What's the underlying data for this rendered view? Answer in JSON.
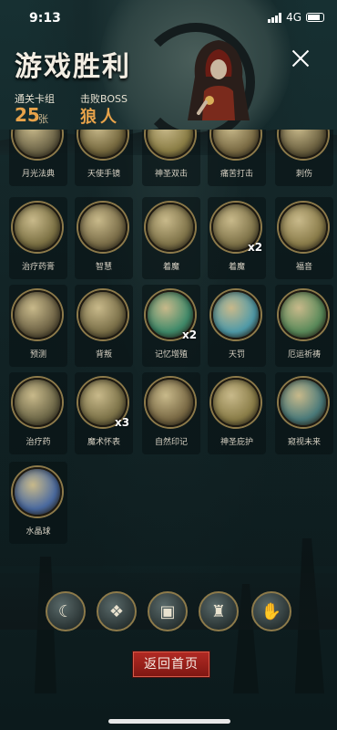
{
  "status_bar": {
    "time": "9:13",
    "network": "4G"
  },
  "header": {
    "title": "游戏胜利",
    "deck_label": "通关卡组",
    "deck_count": "25",
    "deck_unit": "张",
    "boss_label": "击败BOSS",
    "boss_name": "狼人"
  },
  "cards": [
    {
      "label": "月光法典",
      "icon": "book-icon",
      "color": "#6d6548",
      "multiplier": ""
    },
    {
      "label": "天使手镜",
      "icon": "mirror-icon",
      "color": "#76693f",
      "multiplier": ""
    },
    {
      "label": "神圣双击",
      "icon": "holy-hands-icon",
      "color": "#8a7d45",
      "multiplier": ""
    },
    {
      "label": "痛苦打击",
      "icon": "fist-icon",
      "color": "#7a6b44",
      "multiplier": ""
    },
    {
      "label": "刺伤",
      "icon": "dagger-icon",
      "color": "#6e6342",
      "multiplier": ""
    },
    {
      "label": "治疗药膏",
      "icon": "ointment-icon",
      "color": "#7c7144",
      "multiplier": ""
    },
    {
      "label": "智慧",
      "icon": "sage-icon",
      "color": "#7a6d48",
      "multiplier": ""
    },
    {
      "label": "着魔",
      "icon": "possessed-icon",
      "color": "#7f7349",
      "multiplier": ""
    },
    {
      "label": "着魔",
      "icon": "possessed-icon",
      "color": "#7f7349",
      "multiplier": "x2"
    },
    {
      "label": "福音",
      "icon": "hammer-icon",
      "color": "#8a7c4a",
      "multiplier": ""
    },
    {
      "label": "预测",
      "icon": "witch-icon",
      "color": "#6f6446",
      "multiplier": ""
    },
    {
      "label": "背叛",
      "icon": "traitor-icon",
      "color": "#7a6f48",
      "multiplier": ""
    },
    {
      "label": "记忆增殖",
      "icon": "brain-icon",
      "color": "#3f8a6a",
      "multiplier": "x2"
    },
    {
      "label": "天罚",
      "icon": "lightning-icon",
      "color": "#4f9aa8",
      "multiplier": ""
    },
    {
      "label": "厄运祈祷",
      "icon": "curse-icon",
      "color": "#5a8a5a",
      "multiplier": ""
    },
    {
      "label": "治疗药",
      "icon": "potion-icon",
      "color": "#6e6848",
      "multiplier": ""
    },
    {
      "label": "魔术怀表",
      "icon": "pocket-watch-icon",
      "color": "#7c7248",
      "multiplier": "x3"
    },
    {
      "label": "自然印记",
      "icon": "nature-mark-icon",
      "color": "#7a6a45",
      "multiplier": ""
    },
    {
      "label": "神圣庇护",
      "icon": "holy-shield-icon",
      "color": "#8a7d48",
      "multiplier": ""
    },
    {
      "label": "窥视未来",
      "icon": "crystal-eye-icon",
      "color": "#4a7a7a",
      "multiplier": ""
    },
    {
      "label": "水晶球",
      "icon": "crystal-ball-icon",
      "color": "#4a6aa0",
      "multiplier": ""
    }
  ],
  "tray_tokens": [
    {
      "icon": "moon-icon",
      "glyph": "☾"
    },
    {
      "icon": "spellbook-icon",
      "glyph": "❖"
    },
    {
      "icon": "tome-icon",
      "glyph": "▣"
    },
    {
      "icon": "hooded-figure-icon",
      "glyph": "♜"
    },
    {
      "icon": "claw-icon",
      "glyph": "✋"
    }
  ],
  "footer": {
    "home_button": "返回首页"
  }
}
